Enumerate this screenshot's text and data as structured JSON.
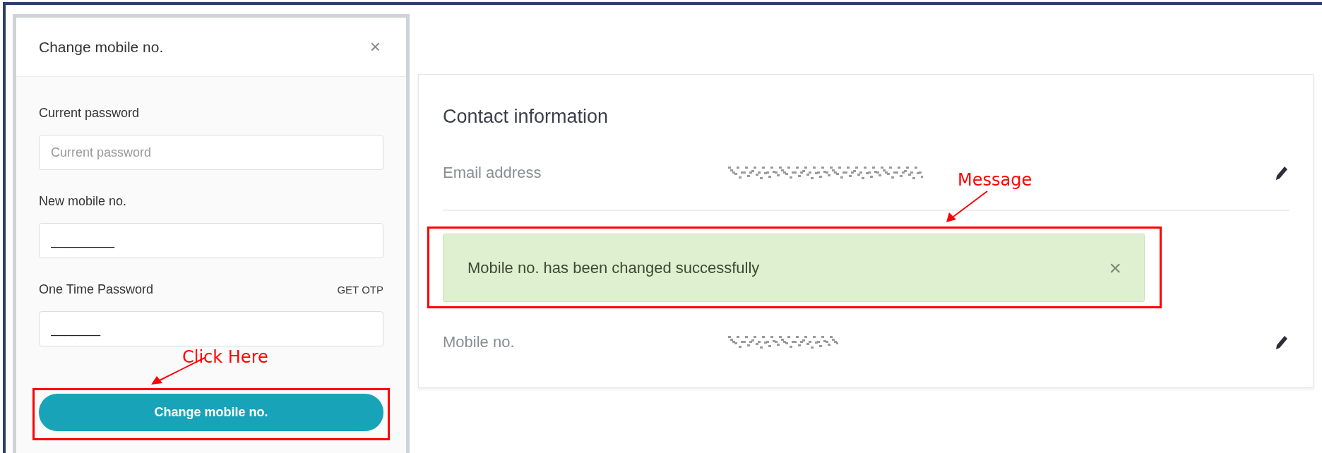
{
  "dialog": {
    "title": "Change mobile no.",
    "close_icon": "×",
    "fields": [
      {
        "label": "Current password",
        "placeholder": "Current password"
      },
      {
        "label": "New mobile no.",
        "value": "_________"
      },
      {
        "label": "One Time Password",
        "action": "GET OTP",
        "value": "_______"
      }
    ],
    "submit": "Change mobile no."
  },
  "contact": {
    "title": "Contact information",
    "rows": [
      {
        "kind": "field",
        "label": "Email address"
      },
      {
        "kind": "message",
        "text": "Mobile no. has been changed successfully",
        "close_icon": "×"
      },
      {
        "kind": "field",
        "label": "Mobile no."
      }
    ]
  },
  "annotations": [
    {
      "text": "Click Here"
    },
    {
      "text": "Message"
    }
  ]
}
